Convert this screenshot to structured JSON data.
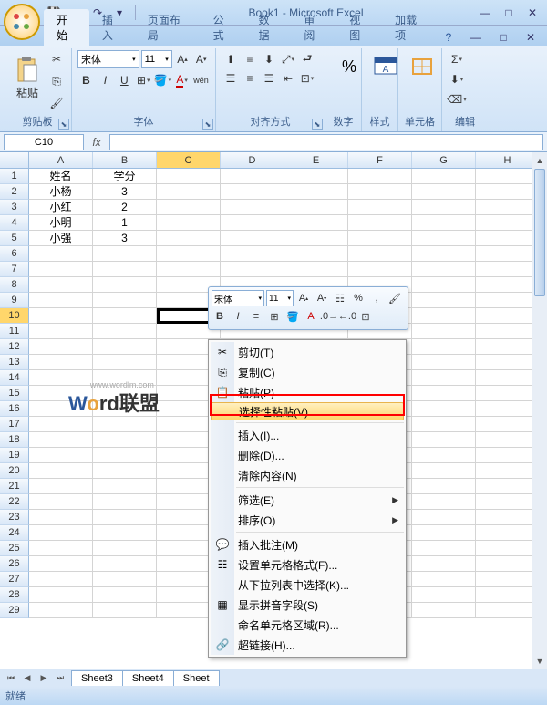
{
  "app": {
    "title": "Book1 - Microsoft Excel"
  },
  "qat": {
    "save": "💾",
    "undo": "↶",
    "redo": "↷"
  },
  "tabs": {
    "items": [
      "开始",
      "插入",
      "页面布局",
      "公式",
      "数据",
      "审阅",
      "视图",
      "加载项"
    ],
    "active": 0
  },
  "ribbon": {
    "clipboard": {
      "paste": "粘贴",
      "label": "剪贴板"
    },
    "font": {
      "name": "宋体",
      "size": "11",
      "label": "字体"
    },
    "align": {
      "label": "对齐方式"
    },
    "number": {
      "label": "数字"
    },
    "style": {
      "label": "样式"
    },
    "cells": {
      "label": "单元格"
    },
    "edit": {
      "label": "编辑"
    }
  },
  "namebox": "C10",
  "columns": [
    "A",
    "B",
    "C",
    "D",
    "E",
    "F",
    "G",
    "H"
  ],
  "sheet_data": {
    "1": {
      "A": "姓名",
      "B": "学分"
    },
    "2": {
      "A": "小杨",
      "B": "3"
    },
    "3": {
      "A": "小红",
      "B": "2"
    },
    "4": {
      "A": "小明",
      "B": "1"
    },
    "5": {
      "A": "小强",
      "B": "3"
    }
  },
  "row_count": 29,
  "watermark": {
    "text": "Word联盟",
    "url": "www.wordlm.com"
  },
  "mini_toolbar": {
    "font": "宋体",
    "size": "11"
  },
  "context_menu": {
    "items": [
      {
        "icon": "cut",
        "label": "剪切(T)"
      },
      {
        "icon": "copy",
        "label": "复制(C)"
      },
      {
        "icon": "paste",
        "label": "粘贴(P)",
        "boxed": true
      },
      {
        "icon": "",
        "label": "选择性粘贴(V)...",
        "hover": true
      },
      {
        "sep": true
      },
      {
        "icon": "",
        "label": "插入(I)..."
      },
      {
        "icon": "",
        "label": "删除(D)..."
      },
      {
        "icon": "",
        "label": "清除内容(N)"
      },
      {
        "sep": true
      },
      {
        "icon": "",
        "label": "筛选(E)",
        "arrow": true
      },
      {
        "icon": "",
        "label": "排序(O)",
        "arrow": true
      },
      {
        "sep": true
      },
      {
        "icon": "comment",
        "label": "插入批注(M)"
      },
      {
        "icon": "format",
        "label": "设置单元格格式(F)..."
      },
      {
        "icon": "",
        "label": "从下拉列表中选择(K)..."
      },
      {
        "icon": "pinyin",
        "label": "显示拼音字段(S)"
      },
      {
        "icon": "",
        "label": "命名单元格区域(R)..."
      },
      {
        "icon": "link",
        "label": "超链接(H)..."
      }
    ]
  },
  "sheets": [
    "Sheet3",
    "Sheet4",
    "Sheet"
  ],
  "status": "就绪"
}
